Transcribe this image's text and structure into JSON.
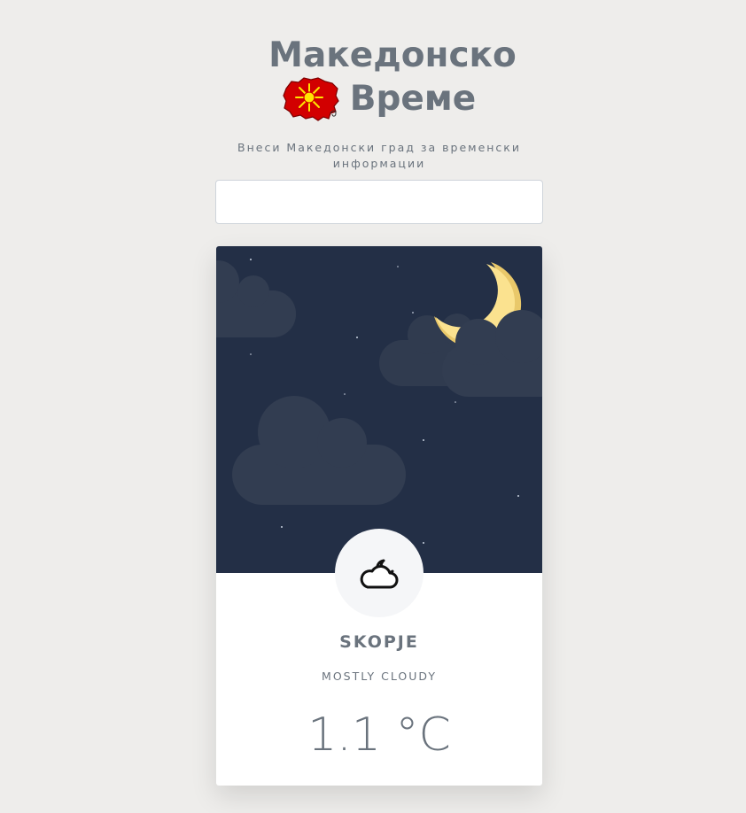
{
  "header": {
    "title_line1": "Македонско",
    "title_line2": "Време",
    "logo_icon": "macedonia-map-sun-icon",
    "subtitle": "Внеси Македонски град за временски информации"
  },
  "search": {
    "value": "",
    "placeholder": ""
  },
  "weather_card": {
    "city": "SKOPJE",
    "condition": "MOSTLY CLOUDY",
    "temperature": "1.1 °C",
    "condition_icon": "night-cloud-moon-icon",
    "scene": "night-sky-moon-clouds"
  },
  "colors": {
    "background": "#eeedeb",
    "sky": "#232f46",
    "cloud": "#323d51",
    "moon": "#fbe28f",
    "text": "#6a737d",
    "flag_red": "#d20000",
    "flag_yellow": "#ffe600"
  }
}
